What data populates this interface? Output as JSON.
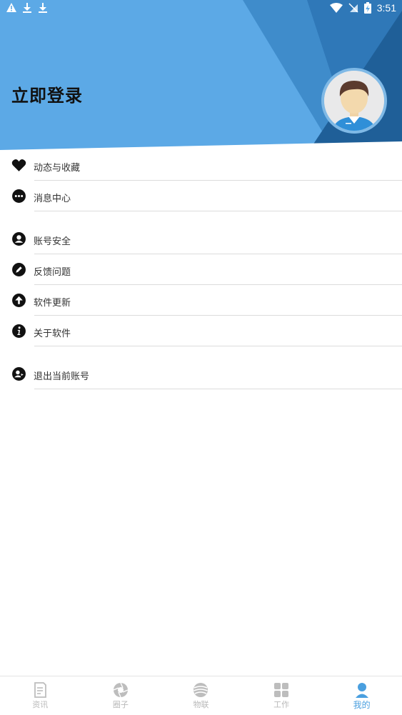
{
  "status_bar": {
    "time": "3:51",
    "left_icons": [
      "warning-icon",
      "download-icon",
      "download-icon"
    ],
    "right_icons": [
      "wifi-icon",
      "no-sim-icon",
      "battery-charging-icon"
    ]
  },
  "header": {
    "title": "立即登录",
    "avatar_icon": "user-avatar-icon",
    "bg_color": "#5ca9e6"
  },
  "menu": {
    "items": [
      {
        "label": "动态与收藏",
        "icon": "heart-icon"
      },
      {
        "label": "消息中心",
        "icon": "chat-icon"
      },
      {
        "label": "账号安全",
        "icon": "account-icon"
      },
      {
        "label": "反馈问题",
        "icon": "pencil-icon"
      },
      {
        "label": "软件更新",
        "icon": "arrow-up-icon"
      },
      {
        "label": "关于软件",
        "icon": "info-icon"
      },
      {
        "label": "退出当前账号",
        "icon": "logout-icon"
      }
    ]
  },
  "tabbar": {
    "tabs": [
      {
        "label": "资讯",
        "icon": "news-icon",
        "active": false
      },
      {
        "label": "圈子",
        "icon": "aperture-icon",
        "active": false
      },
      {
        "label": "物联",
        "icon": "iot-icon",
        "active": false
      },
      {
        "label": "工作",
        "icon": "grid-icon",
        "active": false
      },
      {
        "label": "我的",
        "icon": "profile-icon",
        "active": true
      }
    ],
    "active_color": "#4a9fdf",
    "inactive_color": "#b9b9b9"
  }
}
